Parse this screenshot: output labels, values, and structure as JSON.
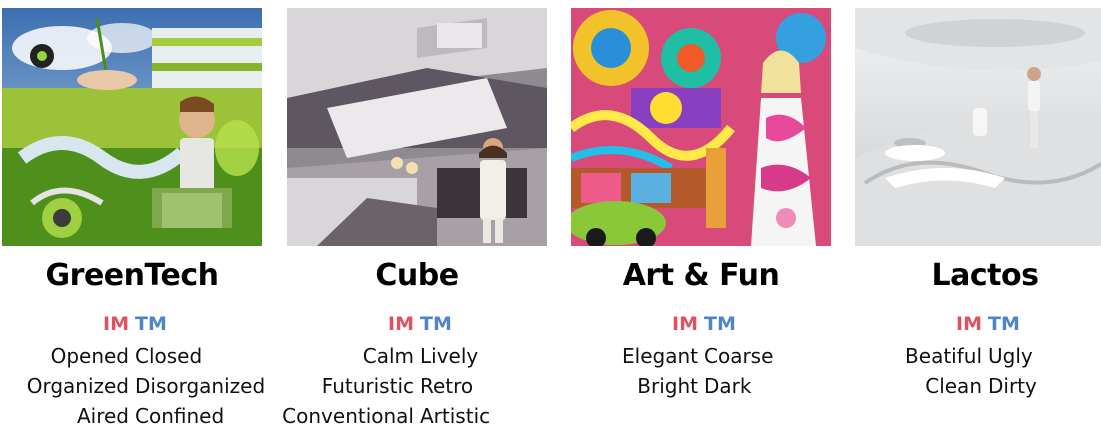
{
  "header_im": "IM",
  "header_tm": "TM",
  "panels": [
    {
      "title": "GreenTech",
      "pairs": [
        {
          "im": "Opened",
          "tm": "Closed"
        },
        {
          "im": "Organized",
          "tm": "Disorganized"
        },
        {
          "im": "Aired",
          "tm": "Confined"
        }
      ]
    },
    {
      "title": "Cube",
      "pairs": [
        {
          "im": "Calm",
          "tm": "Lively"
        },
        {
          "im": "Futuristic",
          "tm": "Retro"
        },
        {
          "im": "Conventional",
          "tm": "Artistic"
        }
      ]
    },
    {
      "title": "Art & Fun",
      "pairs": [
        {
          "im": "Elegant",
          "tm": "Coarse"
        },
        {
          "im": "Bright",
          "tm": "Dark"
        }
      ]
    },
    {
      "title": "Lactos",
      "pairs": [
        {
          "im": "Beatiful",
          "tm": "Ugly"
        },
        {
          "im": "Clean",
          "tm": "Dirty"
        }
      ]
    }
  ]
}
